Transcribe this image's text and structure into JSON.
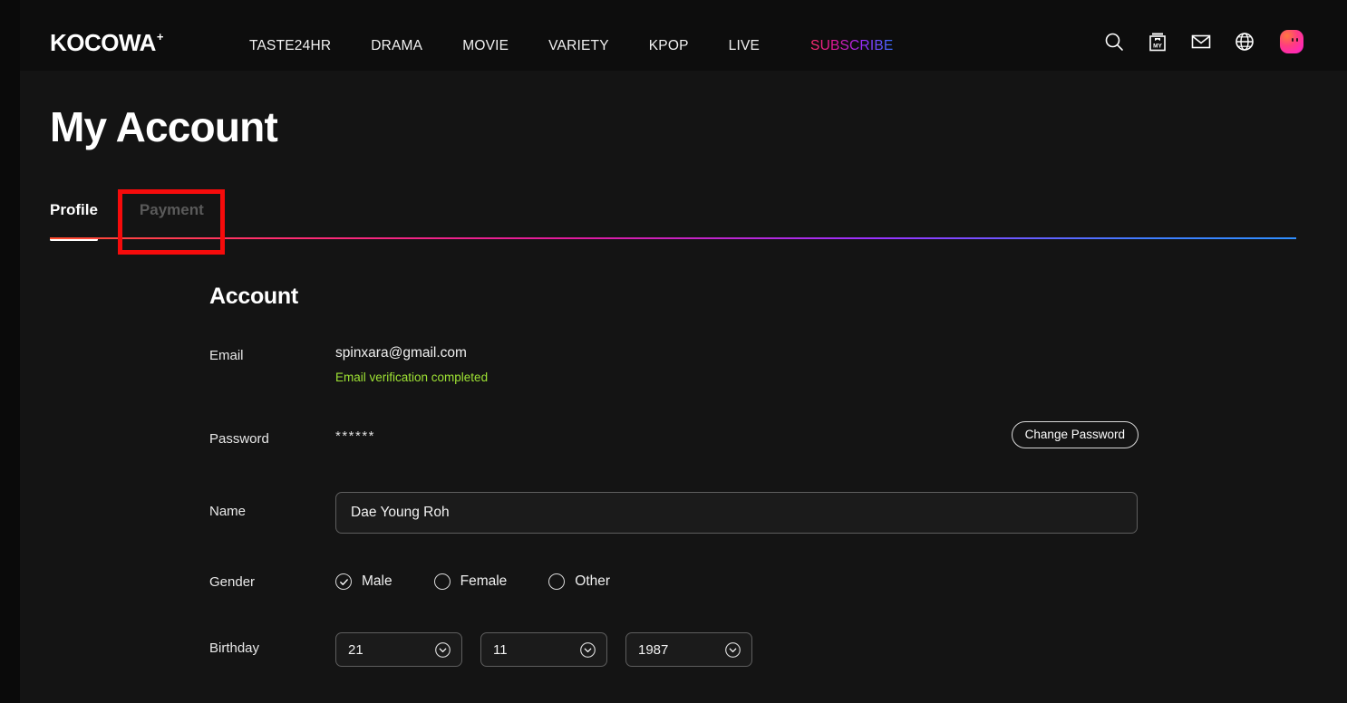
{
  "header": {
    "logo_text": "KOCOWA",
    "logo_plus": "+",
    "nav": [
      {
        "label": "TASTE24HR"
      },
      {
        "label": "DRAMA"
      },
      {
        "label": "MOVIE"
      },
      {
        "label": "VARIETY"
      },
      {
        "label": "KPOP"
      },
      {
        "label": "LIVE"
      }
    ],
    "subscribe_label": "SUBSCRIBE",
    "icons": [
      {
        "name": "search-icon"
      },
      {
        "name": "my-list-icon",
        "text": "MY"
      },
      {
        "name": "mail-icon"
      },
      {
        "name": "globe-icon"
      },
      {
        "name": "avatar"
      }
    ],
    "accent_gradient": [
      "#ff2d6f",
      "#a02cff",
      "#3b6dff"
    ]
  },
  "page": {
    "title": "My Account"
  },
  "tabs": {
    "items": [
      {
        "label": "Profile",
        "active": true
      },
      {
        "label": "Payment",
        "active": false
      }
    ],
    "highlighted": "Payment"
  },
  "account": {
    "section_title": "Account",
    "email": {
      "label": "Email",
      "value": "spinxara@gmail.com",
      "verification_text": "Email verification completed",
      "verification_color": "#9ee234"
    },
    "password": {
      "label": "Password",
      "value": "******",
      "change_button_label": "Change Password"
    },
    "name": {
      "label": "Name",
      "value": "Dae Young Roh",
      "placeholder": "Name"
    },
    "gender": {
      "label": "Gender",
      "options": [
        {
          "label": "Male",
          "selected": true
        },
        {
          "label": "Female",
          "selected": false
        },
        {
          "label": "Other",
          "selected": false
        }
      ]
    },
    "birthday": {
      "label": "Birthday",
      "day": "21",
      "month": "11",
      "year": "1987"
    }
  },
  "annotation": {
    "color": "#f60b0b",
    "target": "Payment"
  }
}
